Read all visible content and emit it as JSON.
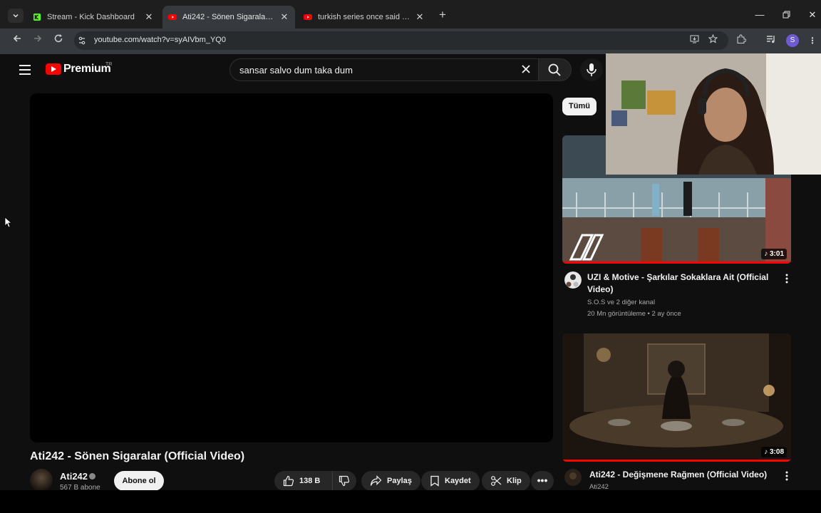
{
  "browser": {
    "tabs": [
      {
        "title": "Stream - Kick Dashboard",
        "favicon": "kick-icon"
      },
      {
        "title": "Ati242 - Sönen Sigaralar (Official Video)",
        "favicon": "youtube-icon",
        "active": true
      },
      {
        "title": "turkish series once said - YouTube",
        "favicon": "youtube-icon"
      }
    ],
    "url": "youtube.com/watch?v=syAIVbm_YQ0",
    "profile_initial": "S"
  },
  "youtube": {
    "logo_text": "Premium",
    "country_code": "TR",
    "search_query": "sansar salvo dum taka dum",
    "video": {
      "title": "Ati242 - Sönen Sigaralar (Official Video)",
      "channel": "Ati242",
      "subscribers": "567 B abone",
      "subscribe_label": "Abone ol",
      "likes": "138 B",
      "share_label": "Paylaş",
      "save_label": "Kaydet",
      "clip_label": "Klip"
    },
    "chips": [
      "Tümü"
    ],
    "related": [
      {
        "title": "UZI & Motive - Şarkılar Sokaklara Ait (Official Video)",
        "channel": "S.O.S ve 2 diğer kanal",
        "views": "20 Mn görüntüleme",
        "age": "2 ay önce",
        "duration": "3:01",
        "progress": 1.0
      },
      {
        "title": "Ati242 - Değişmene Rağmen (Official Video)",
        "channel": "Ati242",
        "duration": "3:08",
        "progress": 1.0
      }
    ]
  },
  "colors": {
    "youtube_red": "#ff0000",
    "background": "#0f0f0f",
    "chrome_tab_bar": "#1e1e1e",
    "chrome_toolbar": "#363a3e",
    "kick_green": "#53fc18"
  }
}
